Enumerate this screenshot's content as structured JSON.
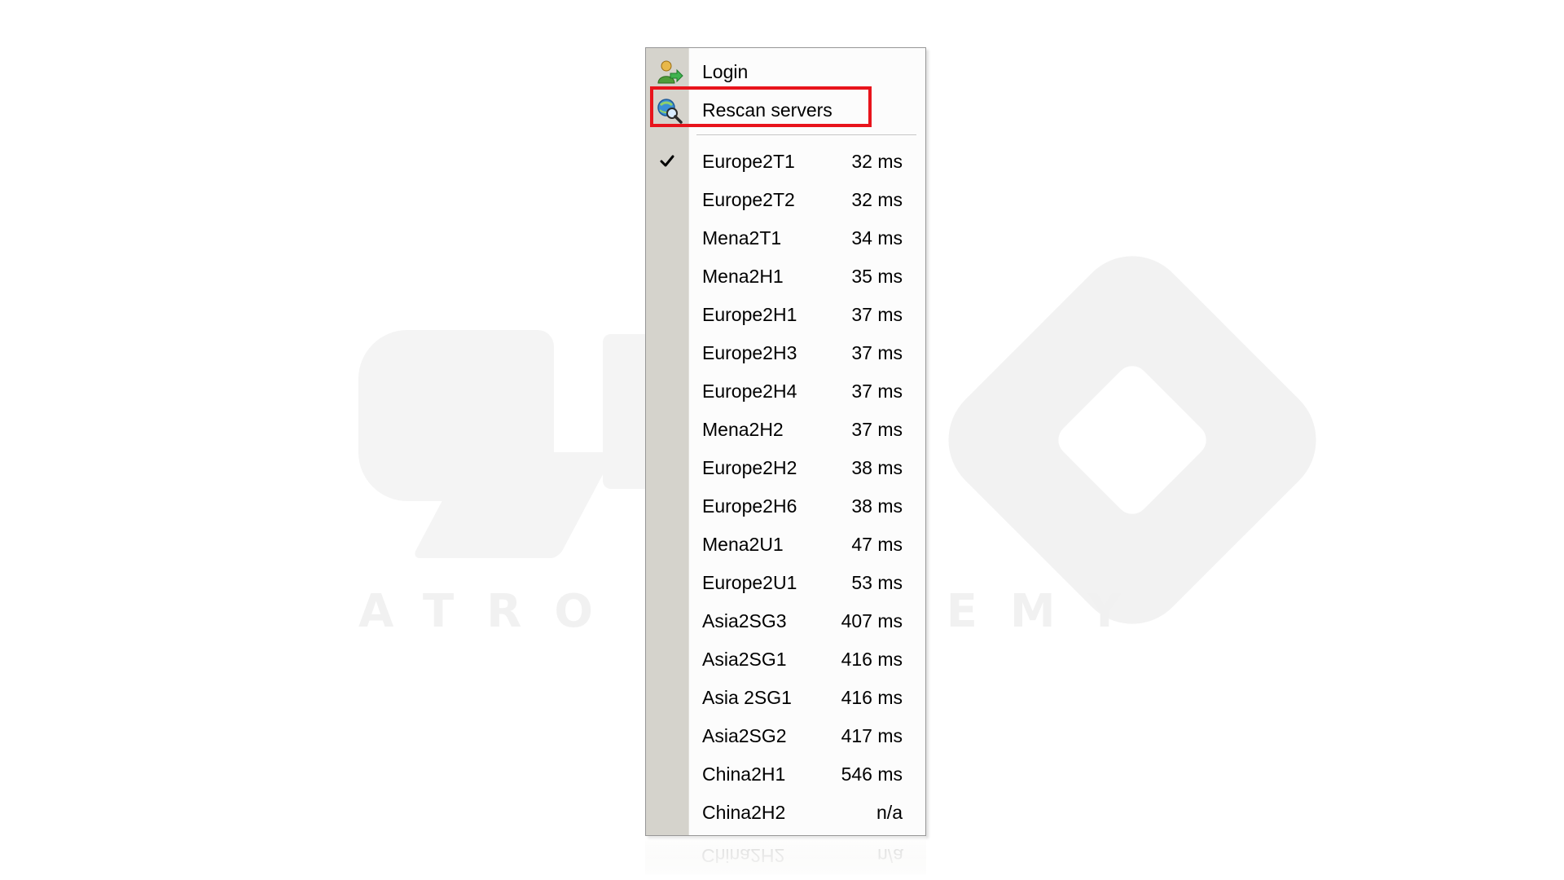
{
  "watermark": {
    "text": "ATRO ACADEMY"
  },
  "menu": {
    "actions": [
      {
        "label": "Login",
        "icon": "login-user-icon"
      },
      {
        "label": "Rescan servers",
        "icon": "rescan-magnifier-icon"
      }
    ],
    "servers": [
      {
        "name": "Europe2T1",
        "ping": "32 ms",
        "checked": true
      },
      {
        "name": "Europe2T2",
        "ping": "32 ms",
        "checked": false
      },
      {
        "name": "Mena2T1",
        "ping": "34 ms",
        "checked": false
      },
      {
        "name": "Mena2H1",
        "ping": "35 ms",
        "checked": false
      },
      {
        "name": "Europe2H1",
        "ping": "37 ms",
        "checked": false
      },
      {
        "name": "Europe2H3",
        "ping": "37 ms",
        "checked": false
      },
      {
        "name": "Europe2H4",
        "ping": "37 ms",
        "checked": false
      },
      {
        "name": "Mena2H2",
        "ping": "37 ms",
        "checked": false
      },
      {
        "name": "Europe2H2",
        "ping": "38 ms",
        "checked": false
      },
      {
        "name": "Europe2H6",
        "ping": "38 ms",
        "checked": false
      },
      {
        "name": "Mena2U1",
        "ping": "47 ms",
        "checked": false
      },
      {
        "name": "Europe2U1",
        "ping": "53 ms",
        "checked": false
      },
      {
        "name": "Asia2SG3",
        "ping": "407 ms",
        "checked": false
      },
      {
        "name": "Asia2SG1",
        "ping": "416 ms",
        "checked": false
      },
      {
        "name": "Asia 2SG1",
        "ping": "416 ms",
        "checked": false
      },
      {
        "name": "Asia2SG2",
        "ping": "417 ms",
        "checked": false
      },
      {
        "name": "China2H1",
        "ping": "546 ms",
        "checked": false
      },
      {
        "name": "China2H2",
        "ping": "n/a",
        "checked": false
      }
    ]
  },
  "colors": {
    "highlight_border": "#e8141c",
    "gutter": "#d5d3cc",
    "menu_background": "#fcfcfc"
  }
}
